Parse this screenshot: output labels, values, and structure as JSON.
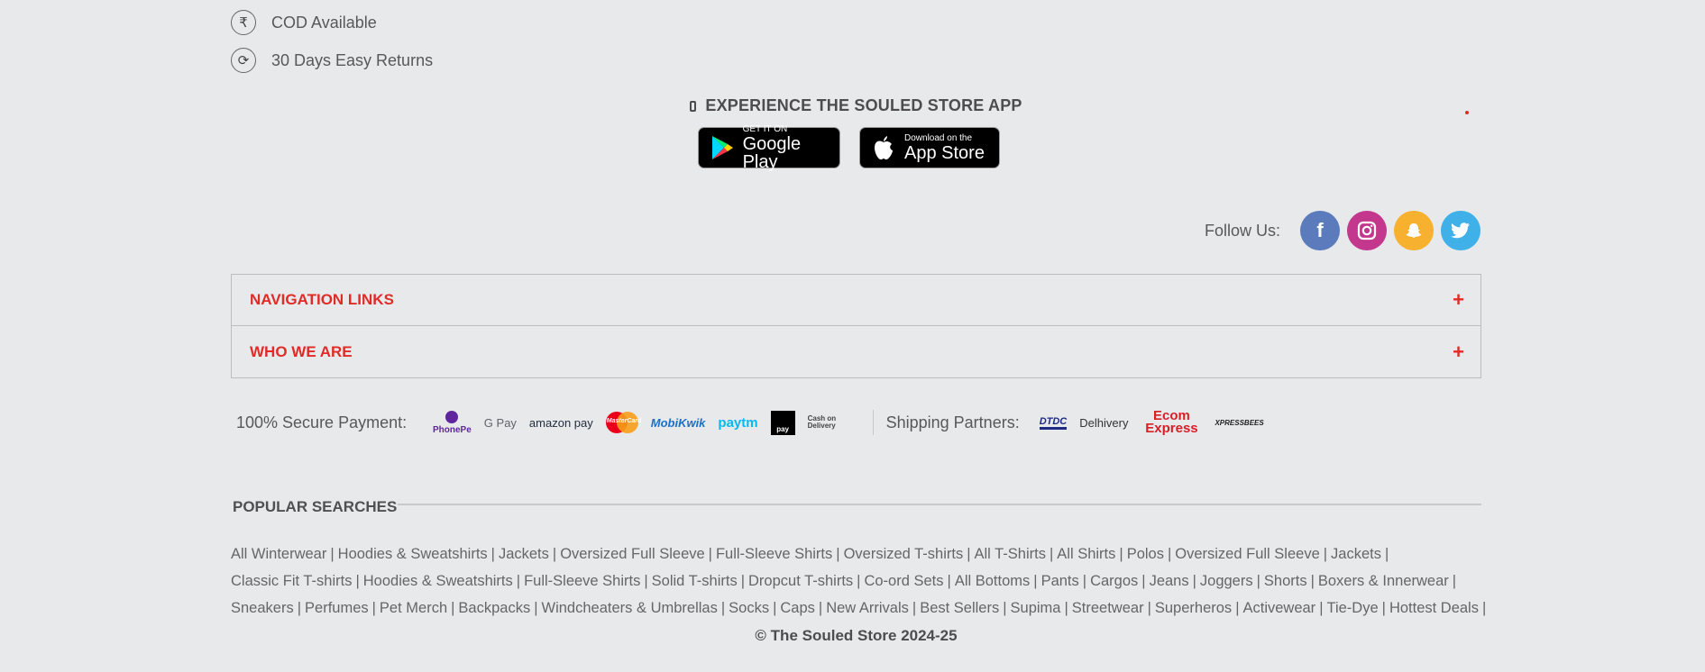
{
  "perks": [
    {
      "icon": "rupee-icon",
      "glyph": "₹",
      "label": "COD Available"
    },
    {
      "icon": "refresh-icon",
      "glyph": "⟳",
      "label": "30 Days Easy Returns"
    }
  ],
  "app": {
    "title": "EXPERIENCE THE SOULED STORE APP",
    "google_play": {
      "small": "GET IT ON",
      "big": "Google Play"
    },
    "app_store": {
      "small": "Download on the",
      "big": "App Store"
    }
  },
  "follow": {
    "label": "Follow Us:",
    "networks": [
      {
        "name": "facebook",
        "glyph": "f",
        "color": "#5b7bbd"
      },
      {
        "name": "instagram",
        "glyph": "◎",
        "color": "#c3388c"
      },
      {
        "name": "snapchat",
        "glyph": "☺",
        "color": "#f7b12e"
      },
      {
        "name": "twitter",
        "glyph": "✦",
        "color": "#3fb0e8"
      }
    ]
  },
  "accordion": [
    {
      "title": "NAVIGATION LINKS",
      "toggle": "+"
    },
    {
      "title": "WHO WE ARE",
      "toggle": "+"
    }
  ],
  "payment": {
    "label": "100% Secure Payment:",
    "methods": [
      "PhonePe",
      "G Pay",
      "amazon pay",
      "MasterCard",
      "MobiKwik",
      "paytm",
      "pay",
      "Cash on Delivery"
    ]
  },
  "shipping": {
    "label": "Shipping Partners:",
    "partners": [
      "DTDC",
      "Delhivery",
      "Ecom Express",
      "XPRESSBEES"
    ]
  },
  "popular": {
    "title": "POPULAR SEARCHES",
    "rows": [
      [
        "All Winterwear",
        "Hoodies & Sweatshirts",
        "Jackets",
        "Oversized Full Sleeve",
        "Full-Sleeve Shirts",
        "Oversized T-shirts",
        "All T-Shirts",
        "All Shirts",
        "Polos",
        "Oversized Full Sleeve",
        "Jackets"
      ],
      [
        "Classic Fit T-shirts",
        "Hoodies & Sweatshirts",
        "Full-Sleeve Shirts",
        "Solid T-shirts",
        "Dropcut T-shirts",
        "Co-ord Sets",
        "All Bottoms",
        "Pants",
        "Cargos",
        "Jeans",
        "Joggers",
        "Shorts",
        "Boxers & Innerwear"
      ],
      [
        "Sneakers",
        "Perfumes",
        "Pet Merch",
        "Backpacks",
        "Windcheaters & Umbrellas",
        "Socks",
        "Caps",
        "New Arrivals",
        "Best Sellers",
        "Supima",
        "Streetwear",
        "Superheros",
        "Activewear",
        "Tie-Dye",
        "Hottest Deals"
      ]
    ]
  },
  "copyright": "© The Souled Store 2024-25",
  "colors": {
    "accent": "#e02b27",
    "background": "#e8e9eb"
  }
}
